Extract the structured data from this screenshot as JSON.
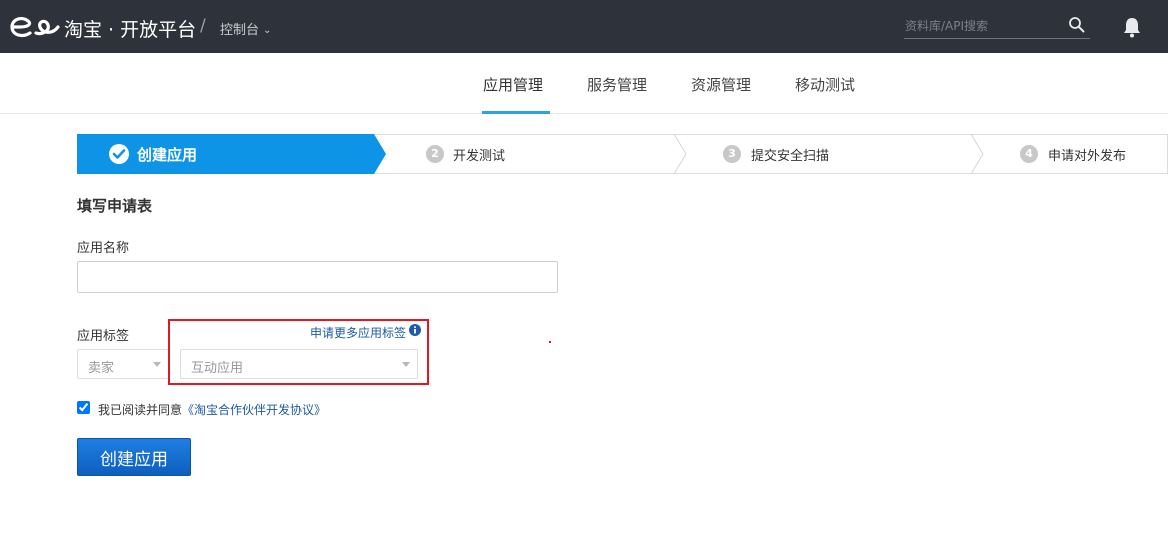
{
  "header": {
    "brand": "淘宝 · 开放平台",
    "separator": "/",
    "console_label": "控制台",
    "search_placeholder": "资料库/API搜索"
  },
  "nav": {
    "items": [
      {
        "label": "应用管理",
        "active": true
      },
      {
        "label": "服务管理",
        "active": false
      },
      {
        "label": "资源管理",
        "active": false
      },
      {
        "label": "移动测试",
        "active": false
      }
    ]
  },
  "steps": [
    {
      "number": "",
      "label": "创建应用",
      "active": true
    },
    {
      "number": "2",
      "label": "开发测试",
      "active": false
    },
    {
      "number": "3",
      "label": "提交安全扫描",
      "active": false
    },
    {
      "number": "4",
      "label": "申请对外发布",
      "active": false
    }
  ],
  "form": {
    "title": "填写申请表",
    "name_label": "应用名称",
    "name_value": "",
    "tags_label": "应用标签",
    "more_tags_link": "申请更多应用标签",
    "tag_primary_value": "卖家",
    "tag_secondary_value": "互动应用",
    "agree_checked": true,
    "agree_prefix": "我已阅读并同意",
    "agree_link": "《淘宝合作伙伴开发协议》",
    "submit_label": "创建应用"
  },
  "colors": {
    "topbar": "#2e323a",
    "accent": "#0e94e6",
    "highlight_box": "#e0181f",
    "link": "#1e5aa8"
  }
}
